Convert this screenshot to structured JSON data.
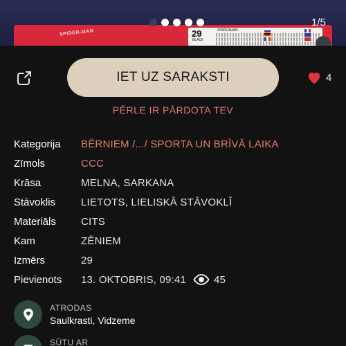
{
  "gallery": {
    "box_brand": "SPIDER-MAN",
    "box_size": "29",
    "box_color": "BLACK",
    "box_model": "SPIDERMAN",
    "page_counter": "1/5",
    "slides_total": 5,
    "slide_current": 1
  },
  "actions": {
    "primary_button": "IET UZ SARAKSTI",
    "like_count": "4"
  },
  "status": {
    "sold_note": "PĒRLE IR PĀRDOTA TEV"
  },
  "details": [
    {
      "label": "Kategorija",
      "value": "BĒRNIEM /.../ SPORTA UN BRĪVĀ LAIKA"
    },
    {
      "label": "Zīmols",
      "value": "CCC"
    },
    {
      "label": "Krāsa",
      "value": "MELNA, SARKANA"
    },
    {
      "label": "Stāvoklis",
      "value": "LIETOTS, LIELISKĀ STĀVOKLĪ"
    },
    {
      "label": "Materiāls",
      "value": "CITS"
    },
    {
      "label": "Kam",
      "value": "ZĒNIEM"
    },
    {
      "label": "Izmērs",
      "value": "29"
    },
    {
      "label": "Pievienots",
      "value": "13. OKTOBRIS, 09:41",
      "views": "45"
    }
  ],
  "location": {
    "label": "ATRODAS",
    "value": "Saulkrasti, Vidzeme"
  },
  "shipping": {
    "label": "SŪTU AR"
  },
  "colors": {
    "background": "#121212",
    "accent": "#e07d73",
    "button": "#dcd0bc",
    "heart": "#e0333f",
    "location_circle": "#2f4a3c"
  }
}
